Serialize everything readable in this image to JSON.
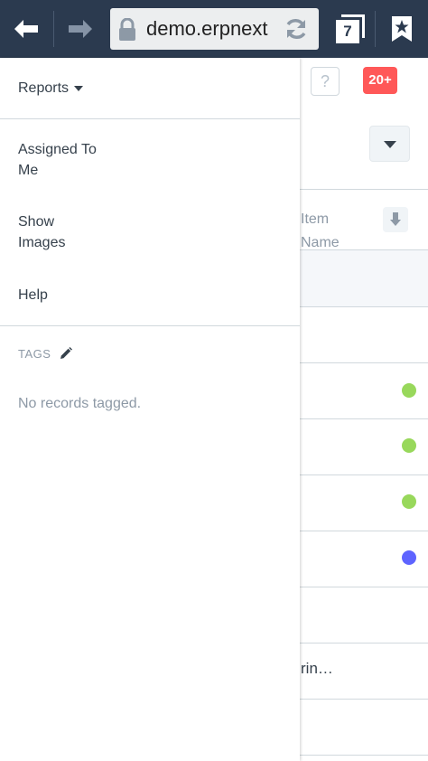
{
  "browser": {
    "url": "demo.erpnext",
    "tab_count": "7",
    "icons": {
      "back": "back-arrow-icon",
      "forward": "forward-arrow-icon",
      "lock": "lock-icon",
      "reload": "reload-icon",
      "tabs": "tabs-icon",
      "bookmark": "bookmark-star-icon"
    }
  },
  "page": {
    "help_label": "?",
    "notification_count": "20+",
    "column_header": "Item\nName",
    "truncated_row_text": "rin…",
    "status_dots": [
      {
        "color": "#98d85b"
      },
      {
        "color": "#98d85b"
      },
      {
        "color": "#98d85b"
      },
      {
        "color": "#5e64ff"
      }
    ]
  },
  "sidebar": {
    "reports_label": "Reports",
    "items": [
      {
        "label": "Assigned To\nMe"
      },
      {
        "label": "Show\nImages"
      },
      {
        "label": "Help"
      }
    ],
    "tags_label": "TAGS",
    "no_tags_text": "No records tagged."
  },
  "colors": {
    "toolbar_bg": "#2b3a4f",
    "notification_red": "#ff5858",
    "status_green": "#98d85b",
    "status_blue": "#5e64ff"
  }
}
